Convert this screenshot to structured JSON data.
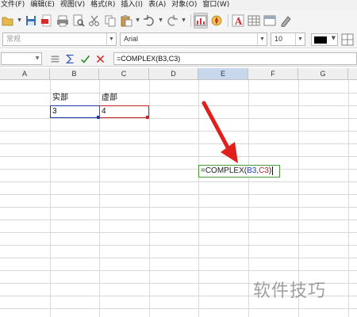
{
  "menu": {
    "items": [
      "文件(F)",
      "编辑(E)",
      "视图(V)",
      "格式(R)",
      "插入(I)",
      "表(A)",
      "对象(O)",
      "窗口(W)"
    ]
  },
  "toolbar": {
    "icons": [
      "open-icon",
      "save-icon",
      "export-pdf-icon",
      "print-icon",
      "print-preview-icon",
      "cut-icon",
      "copy-icon",
      "paste-icon",
      "undo-icon",
      "redo-icon",
      "chart-icon",
      "navigator-icon",
      "fontwork-icon",
      "table-icon",
      "bold-cell-icon",
      "clear-formatting-icon"
    ]
  },
  "format_bar": {
    "style_value": "常规",
    "font_name": "Arial",
    "font_size": "10",
    "font_color": "#000000"
  },
  "formula_bar": {
    "name_box": "",
    "formula": "=COMPLEX(B3,C3)"
  },
  "sheet": {
    "columns": [
      "A",
      "B",
      "C",
      "D",
      "E",
      "F",
      "G"
    ],
    "selected_column": "E",
    "cells": {
      "B2": "实部",
      "C2": "虚部",
      "B3": "3",
      "C3": "4"
    },
    "editing": {
      "prefix": "=COMPLEX(",
      "ref1": "B3",
      "sep": ",",
      "ref2": "C3",
      "suffix": ")"
    }
  },
  "colors": {
    "ref1": "#1f3aa8",
    "ref2": "#c52424",
    "edit_border": "#4b9a3a",
    "arrow": "#e0201b"
  },
  "watermark": "软件技巧"
}
